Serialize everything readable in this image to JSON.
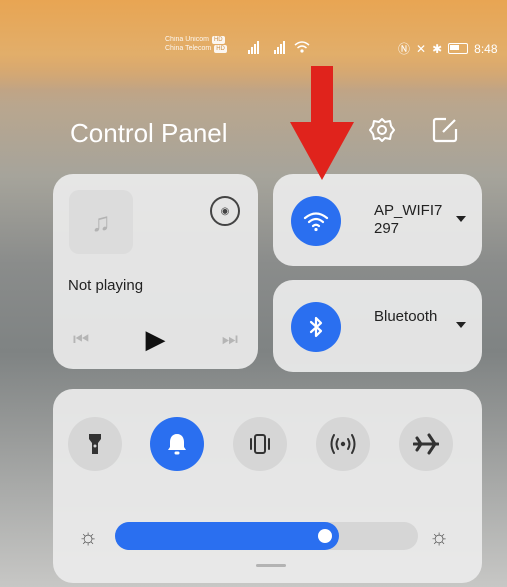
{
  "status_bar": {
    "carrier_1": "China Unicom",
    "carrier_2": "China Telecom",
    "carrier_badge": "HD",
    "time": "8:48"
  },
  "header": {
    "title": "Control Panel"
  },
  "media": {
    "status": "Not playing"
  },
  "wifi": {
    "label": "AP_WIFI7297"
  },
  "bluetooth": {
    "label": "Bluetooth"
  },
  "brightness": {
    "level_percent": 74
  },
  "colors": {
    "accent": "#2a6ff0",
    "arrow": "#e0231c"
  },
  "icons": {
    "settings": "gear-icon",
    "edit": "edit-icon",
    "wifi": "wifi-icon",
    "bluetooth": "bluetooth-icon",
    "flashlight": "flashlight-icon",
    "bell": "bell-icon",
    "vibrate": "vibrate-icon",
    "hotspot": "hotspot-icon",
    "airplane": "airplane-icon",
    "cast": "audio-output-icon"
  }
}
